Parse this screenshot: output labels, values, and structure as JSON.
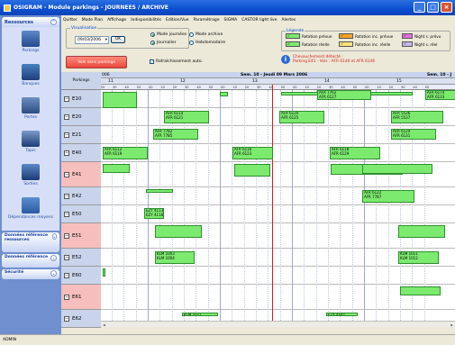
{
  "window": {
    "title": "OSIGRAM - Module parkings - JOURNEES / ARCHIVE"
  },
  "menu": [
    "Quitter",
    "Mode Plan",
    "Affichage",
    "Indisponibilités",
    "Edition/Vue",
    "Paramétrage",
    "SIGMA",
    "CASTOR light live",
    "Alertes"
  ],
  "sidebar": {
    "section_ressources": "Ressources",
    "items": [
      {
        "label": "Parkings",
        "icon": "parking-icon"
      },
      {
        "label": "Banques",
        "icon": "bank-icon"
      },
      {
        "label": "Portes",
        "icon": "door-icon"
      },
      {
        "label": "Tapis",
        "icon": "belt-icon"
      },
      {
        "label": "Sorties",
        "icon": "exit-icon"
      },
      {
        "label": "Dépendances moyens",
        "icon": "dependency-icon"
      }
    ],
    "section_donnees_ressources": "Données référence ressources",
    "section_donnees_reference": "Données référence",
    "section_securite": "Sécurité"
  },
  "visualisation": {
    "title": "Visualisation",
    "date": "09/03/2006",
    "ok": "OK",
    "opt_journee": "Mode journées",
    "opt_archive": "Mode archive",
    "opt_journalier": "Journalier",
    "opt_hebdo": "Hebdomadaire"
  },
  "vol_sans_parking": "Vols sans parkings",
  "refresh_label": "Rafraîchissement auto.",
  "legende": {
    "title": "Légende",
    "items": [
      {
        "label": "Rotation prévue",
        "color": "#7cea6e"
      },
      {
        "label": "Rotation réelle",
        "color": "#7cea6e"
      },
      {
        "label": "Rotation inc. prévue",
        "color": "#f6a623"
      },
      {
        "label": "Rotation inc. réelle",
        "color": "#f6e47c"
      },
      {
        "label": "Night s. prévu",
        "color": "#e46fe0"
      },
      {
        "label": "Night s. réel",
        "color": "#c7b8f0"
      }
    ]
  },
  "warning": {
    "line1": "Chevauchement détecté :",
    "line2": "Parking  E41 - Vols : AFR 6140 et  AFR 6146"
  },
  "gantt": {
    "row_header": "Parkings",
    "week_left": "006",
    "week_mid": "Sem. 10 - Jeudi 09 Mars 2006",
    "week_right": "Sem. 10 - J",
    "hours": [
      "11",
      "12",
      "13",
      "14",
      "15"
    ],
    "minutes": [
      "00",
      "10",
      "20",
      "30",
      "40",
      "50"
    ],
    "rows": [
      "E10",
      "E20",
      "E21",
      "E40",
      "E41",
      "E42",
      "E50",
      "E51",
      "E52",
      "E60",
      "E61",
      "E62"
    ],
    "bars": [
      {
        "row": 0,
        "l1": "AFR 7762",
        "l2": "AFR 6127"
      },
      {
        "row": 0,
        "l1": "AFR 6174",
        "l2": "AFR 6133"
      },
      {
        "row": 1,
        "l1": "AFR 6114",
        "l2": "AFR 6121"
      },
      {
        "row": 1,
        "l1": "AFR 6120",
        "l2": "AFR 6125"
      },
      {
        "row": 1,
        "l1": "AFR 5536",
        "l2": "AFR 5537"
      },
      {
        "row": 2,
        "l1": "AFR 7782",
        "l2": "AFR 7785"
      },
      {
        "row": 2,
        "l1": "AFR 6124",
        "l2": "AFR 6131"
      },
      {
        "row": 3,
        "l1": "AFR 6112",
        "l2": "AFR 6119"
      },
      {
        "row": 3,
        "l1": "AFR 6116",
        "l2": "AFR 6123"
      },
      {
        "row": 3,
        "l1": "AFR 6118",
        "l2": "AFR 6129"
      },
      {
        "row": 5,
        "l1": "AFR 6122",
        "l2": "AFR 7787"
      },
      {
        "row": 6,
        "l1": "EZY 4113",
        "l2": "EZY 4118"
      },
      {
        "row": 8,
        "l1": "KLM 1003",
        "l2": "KLM 1004"
      },
      {
        "row": 8,
        "l1": "KLM 1011",
        "l2": "KLM 1012"
      },
      {
        "row": 11,
        "l1": "KLM 1021",
        "l2": ""
      },
      {
        "row": 11,
        "l1": "EZY 4441",
        "l2": ""
      }
    ]
  },
  "status": "ADMIN"
}
